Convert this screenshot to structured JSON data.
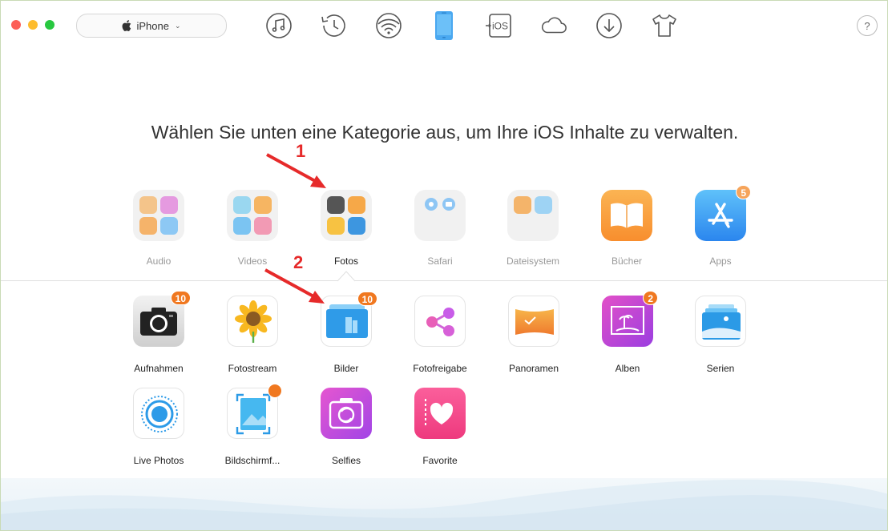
{
  "window": {
    "traffic_lights": [
      "close",
      "minimize",
      "zoom"
    ]
  },
  "device_selector": {
    "label": "iPhone",
    "icon": "apple-icon",
    "chevron": "⌄"
  },
  "toolbar": {
    "icons": [
      "music-icon",
      "history-icon",
      "wifi-icon",
      "iphone-icon",
      "to-ios-icon",
      "cloud-icon",
      "download-icon",
      "tshirt-icon"
    ],
    "to_ios_text": "iOS",
    "help_label": "?"
  },
  "heading": "Wählen Sie unten eine Kategorie aus, um Ihre iOS Inhalte zu verwalten.",
  "categories": [
    {
      "label": "Audio"
    },
    {
      "label": "Videos"
    },
    {
      "label": "Fotos",
      "active": true
    },
    {
      "label": "Safari"
    },
    {
      "label": "Dateisystem"
    },
    {
      "label": "Bücher"
    },
    {
      "label": "Apps",
      "badge": "5"
    }
  ],
  "photo_items": [
    {
      "label": "Aufnahmen",
      "badge": "10"
    },
    {
      "label": "Fotostream"
    },
    {
      "label": "Bilder",
      "badge": "10"
    },
    {
      "label": "Fotofreigabe"
    },
    {
      "label": "Panoramen"
    },
    {
      "label": "Alben",
      "badge": "2"
    },
    {
      "label": "Serien"
    },
    {
      "label": "Live Photos"
    },
    {
      "label": "Bildschirmf..."
    },
    {
      "label": "Selfies"
    },
    {
      "label": "Favorite"
    }
  ],
  "annotations": {
    "step1": "1",
    "step2": "2"
  },
  "colors": {
    "accent": "#3a8ee6",
    "badge": "#f07820",
    "arrow": "#e62a2a"
  }
}
